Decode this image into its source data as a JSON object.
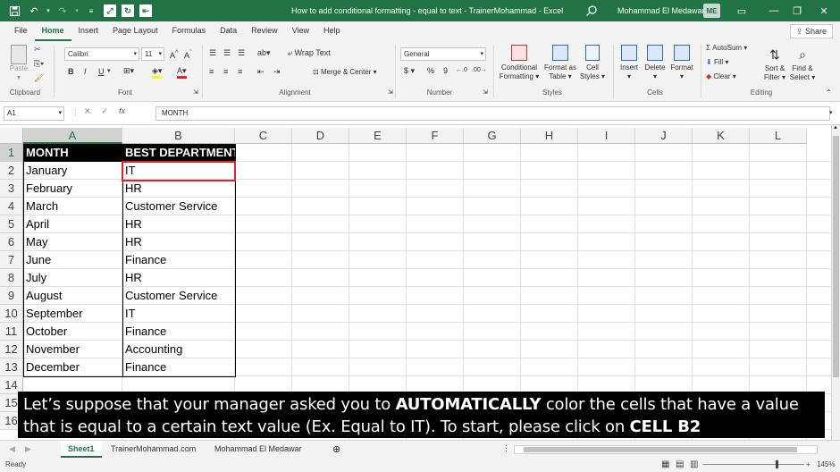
{
  "titlebar": {
    "doc_title": "How to add conditional formatting - equal to text - TrainerMohammad  -  Excel",
    "user_name": "Mohammad El Medawar",
    "user_initials": "ME"
  },
  "menu": {
    "tabs": [
      "File",
      "Home",
      "Insert",
      "Page Layout",
      "Formulas",
      "Data",
      "Review",
      "View",
      "Help"
    ],
    "share": "Share"
  },
  "ribbon": {
    "clipboard": {
      "paste": "Paste",
      "label": "Clipboard"
    },
    "font": {
      "name": "Calibri",
      "size": "11",
      "label": "Font",
      "bold": "B",
      "italic": "I",
      "underline": "U"
    },
    "alignment": {
      "wrap": "Wrap Text",
      "merge": "Merge & Center",
      "label": "Alignment"
    },
    "number": {
      "format": "General",
      "currency": "$",
      "percent": "%",
      "comma": "9",
      "label": "Number"
    },
    "styles": {
      "conditional": "Conditional",
      "conditional2": "Formatting",
      "format_as": "Format as",
      "format_as2": "Table",
      "cell_styles": "Cell",
      "cell_styles2": "Styles",
      "label": "Styles"
    },
    "cells": {
      "insert": "Insert",
      "delete": "Delete",
      "format": "Format",
      "label": "Cells"
    },
    "editing": {
      "autosum": "AutoSum",
      "fill": "Fill",
      "clear": "Clear",
      "sort": "Sort &",
      "sort2": "Filter",
      "find": "Find &",
      "find2": "Select",
      "label": "Editing"
    }
  },
  "formula_bar": {
    "name_box": "A1",
    "formula": "MONTH"
  },
  "columns": [
    "A",
    "B",
    "C",
    "D",
    "E",
    "F",
    "G",
    "H",
    "I",
    "J",
    "K",
    "L"
  ],
  "rows": [
    "1",
    "2",
    "3",
    "4",
    "5",
    "6",
    "7",
    "8",
    "9",
    "10",
    "11",
    "12",
    "13",
    "14",
    "15",
    "16"
  ],
  "table": {
    "header": [
      "MONTH",
      "BEST DEPARTMENT"
    ],
    "rows": [
      [
        "January",
        "IT"
      ],
      [
        "February",
        "HR"
      ],
      [
        "March",
        "Customer Service"
      ],
      [
        "April",
        "HR"
      ],
      [
        "May",
        "HR"
      ],
      [
        "June",
        "Finance"
      ],
      [
        "July",
        "HR"
      ],
      [
        "August",
        "Customer Service"
      ],
      [
        "September",
        "IT"
      ],
      [
        "October",
        "Finance"
      ],
      [
        "November",
        "Accounting"
      ],
      [
        "December",
        "Finance"
      ]
    ]
  },
  "caption": {
    "part1": "Let’s suppose that your manager asked you to ",
    "bold1": "AUTOMATICALLY",
    "part2": " color the cells that have a value that is equal to a certain text value (Ex. Equal to IT). To start, please click on ",
    "bold2": "CELL B2"
  },
  "sheets": [
    "Sheet1",
    "TrainerMohammad.com",
    "Mohammad El Medawar"
  ],
  "status": {
    "ready": "Ready",
    "zoom": "145%"
  },
  "colors": {
    "accent": "#217346",
    "highlight": "#e0202a"
  }
}
